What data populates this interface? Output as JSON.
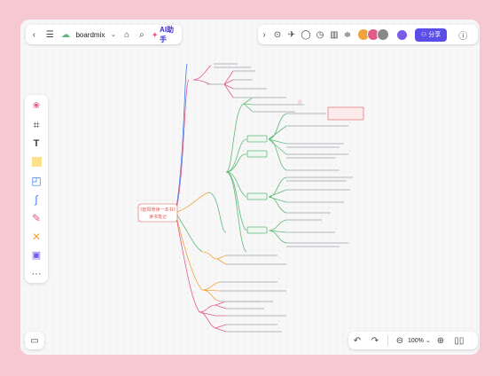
{
  "toolbar": {
    "brand": "boardmix",
    "ai_label": "AI助手",
    "share_label": "分享"
  },
  "mindmap": {
    "root_line1": "《欧阳修读一本书》",
    "root_line2": "读书笔记"
  },
  "zoom": {
    "level": "100%"
  },
  "icons": {
    "back": "chevron-left-icon",
    "menu": "menu-icon",
    "tag": "tag-icon",
    "search": "search-icon",
    "help": "help-icon"
  },
  "colors": {
    "accent": "#5b4ee8",
    "background": "#f6c9d2",
    "green": "#5fb878",
    "orange": "#f0a33a",
    "pink": "#e05a8a",
    "blue": "#3b7ce8"
  }
}
